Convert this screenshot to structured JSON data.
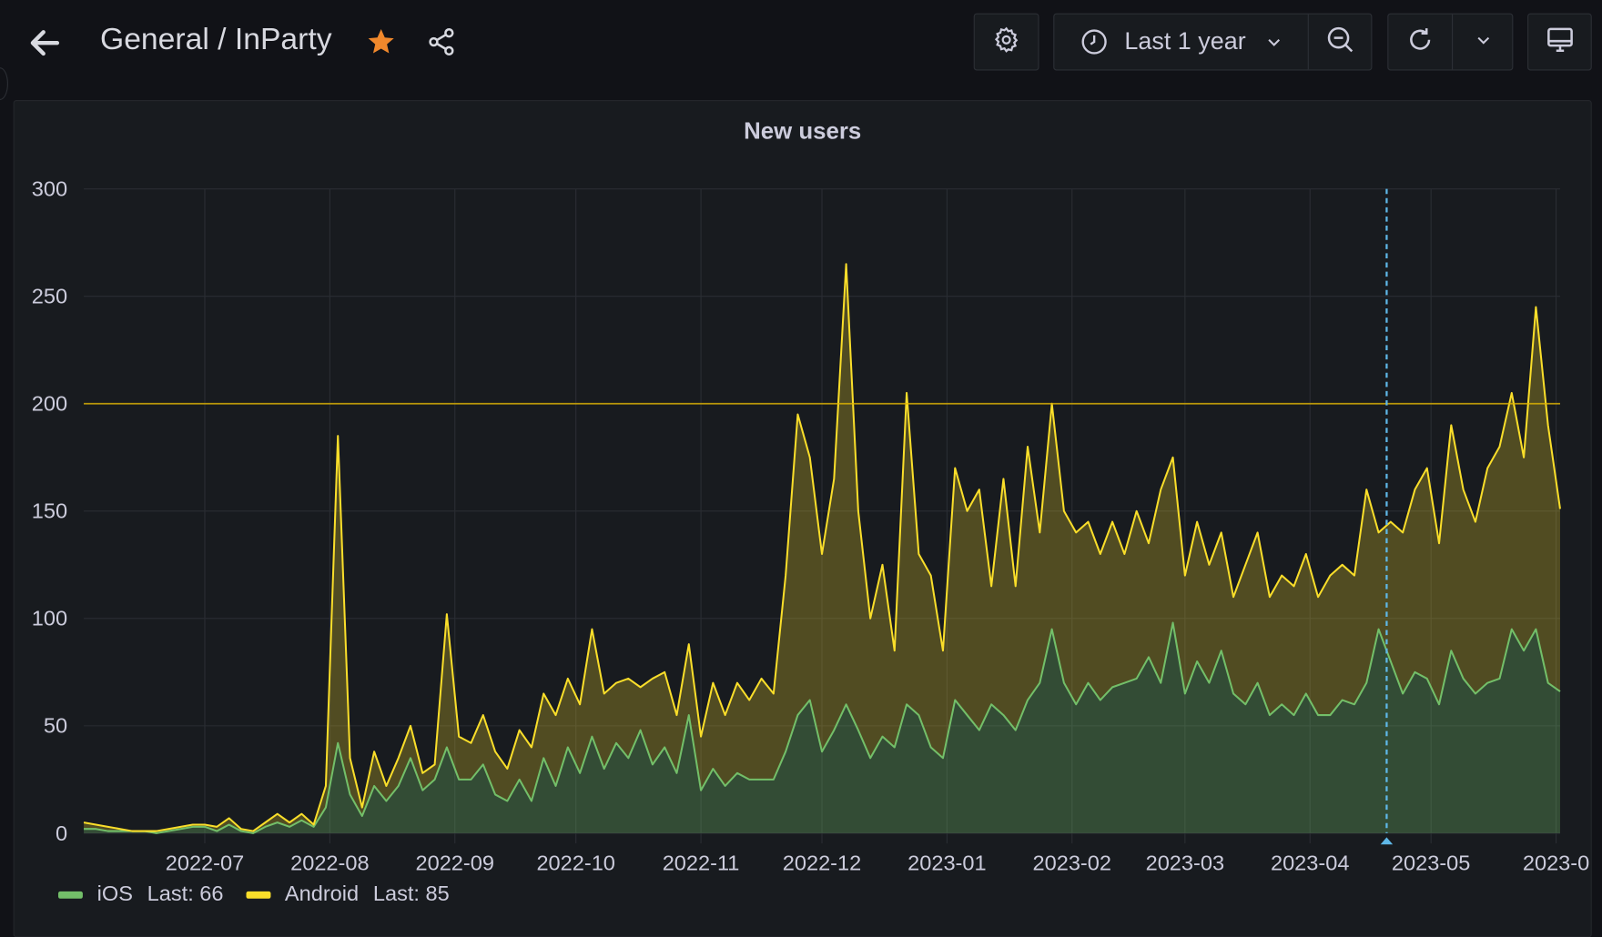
{
  "header": {
    "breadcrumb_folder": "General",
    "breadcrumb_sep": " / ",
    "dashboard_title": "InParty",
    "time_range": "Last 1 year",
    "icons": [
      "arrow-left-icon",
      "star-icon",
      "share-icon",
      "gear-icon",
      "clock-icon",
      "chevron-down-icon",
      "zoom-out-icon",
      "refresh-icon",
      "monitor-icon"
    ],
    "star_color": "#f0882c"
  },
  "panel": {
    "title": "New users"
  },
  "legend": [
    {
      "name": "iOS",
      "stat": "Last: 66",
      "color": "#73bf69"
    },
    {
      "name": "Android",
      "stat": "Last: 85",
      "color": "#fade2a"
    }
  ],
  "chart_data": {
    "type": "area",
    "stacked": true,
    "title": "New users",
    "xlabel": "",
    "ylabel": "",
    "ylim": [
      0,
      300
    ],
    "yticks": [
      "0",
      "50",
      "100",
      "150",
      "200",
      "250",
      "300"
    ],
    "xlim": [
      "2022-06-01",
      "2023-06-02"
    ],
    "xtick_labels": [
      "2022-07",
      "2022-08",
      "2022-09",
      "2022-10",
      "2022-11",
      "2022-12",
      "2023-01",
      "2023-02",
      "2023-03",
      "2023-04",
      "2023-05",
      "2023-0"
    ],
    "xtick_dates": [
      "2022-07-01",
      "2022-08-01",
      "2022-09-01",
      "2022-10-01",
      "2022-11-01",
      "2022-12-01",
      "2023-01-01",
      "2023-02-01",
      "2023-03-01",
      "2023-04-01",
      "2023-05-01",
      "2023-06-01"
    ],
    "grid": true,
    "legend_position": "bottom-left",
    "threshold": {
      "value": 200,
      "color": "#e0b400"
    },
    "cursor_date": "2023-04-20",
    "cursor_color": "#5fb8e8",
    "x": [
      "2022-06-01",
      "2022-06-04",
      "2022-06-07",
      "2022-06-10",
      "2022-06-13",
      "2022-06-16",
      "2022-06-19",
      "2022-06-22",
      "2022-06-25",
      "2022-06-28",
      "2022-07-01",
      "2022-07-04",
      "2022-07-07",
      "2022-07-10",
      "2022-07-13",
      "2022-07-16",
      "2022-07-19",
      "2022-07-22",
      "2022-07-25",
      "2022-07-28",
      "2022-07-31",
      "2022-08-03",
      "2022-08-06",
      "2022-08-09",
      "2022-08-12",
      "2022-08-15",
      "2022-08-18",
      "2022-08-21",
      "2022-08-24",
      "2022-08-27",
      "2022-08-30",
      "2022-09-02",
      "2022-09-05",
      "2022-09-08",
      "2022-09-11",
      "2022-09-14",
      "2022-09-17",
      "2022-09-20",
      "2022-09-23",
      "2022-09-26",
      "2022-09-29",
      "2022-10-02",
      "2022-10-05",
      "2022-10-08",
      "2022-10-11",
      "2022-10-14",
      "2022-10-17",
      "2022-10-20",
      "2022-10-23",
      "2022-10-26",
      "2022-10-29",
      "2022-11-01",
      "2022-11-04",
      "2022-11-07",
      "2022-11-10",
      "2022-11-13",
      "2022-11-16",
      "2022-11-19",
      "2022-11-22",
      "2022-11-25",
      "2022-11-28",
      "2022-12-01",
      "2022-12-04",
      "2022-12-07",
      "2022-12-10",
      "2022-12-13",
      "2022-12-16",
      "2022-12-19",
      "2022-12-22",
      "2022-12-25",
      "2022-12-28",
      "2022-12-31",
      "2023-01-03",
      "2023-01-06",
      "2023-01-09",
      "2023-01-12",
      "2023-01-15",
      "2023-01-18",
      "2023-01-21",
      "2023-01-24",
      "2023-01-27",
      "2023-01-30",
      "2023-02-02",
      "2023-02-05",
      "2023-02-08",
      "2023-02-11",
      "2023-02-14",
      "2023-02-17",
      "2023-02-20",
      "2023-02-23",
      "2023-02-26",
      "2023-03-01",
      "2023-03-04",
      "2023-03-07",
      "2023-03-10",
      "2023-03-13",
      "2023-03-16",
      "2023-03-19",
      "2023-03-22",
      "2023-03-25",
      "2023-03-28",
      "2023-03-31",
      "2023-04-03",
      "2023-04-06",
      "2023-04-09",
      "2023-04-12",
      "2023-04-15",
      "2023-04-18",
      "2023-04-21",
      "2023-04-24",
      "2023-04-27",
      "2023-04-30",
      "2023-05-03",
      "2023-05-06",
      "2023-05-09",
      "2023-05-12",
      "2023-05-15",
      "2023-05-18",
      "2023-05-21",
      "2023-05-24",
      "2023-05-27",
      "2023-05-30",
      "2023-06-02"
    ],
    "series": [
      {
        "name": "iOS",
        "color": "#73bf69",
        "values": [
          2,
          2,
          1,
          1,
          1,
          1,
          0,
          1,
          2,
          3,
          3,
          1,
          4,
          1,
          0,
          3,
          5,
          3,
          6,
          3,
          12,
          42,
          18,
          8,
          22,
          15,
          22,
          35,
          20,
          25,
          40,
          25,
          25,
          32,
          18,
          15,
          25,
          15,
          35,
          22,
          40,
          28,
          45,
          30,
          42,
          35,
          48,
          32,
          40,
          28,
          55,
          20,
          30,
          22,
          28,
          25,
          25,
          25,
          38,
          55,
          62,
          38,
          48,
          60,
          48,
          35,
          45,
          40,
          60,
          55,
          40,
          35,
          62,
          55,
          48,
          60,
          55,
          48,
          62,
          70,
          95,
          70,
          60,
          70,
          62,
          68,
          70,
          72,
          82,
          70,
          98,
          65,
          80,
          70,
          85,
          65,
          60,
          70,
          55,
          60,
          55,
          65,
          55,
          55,
          62,
          60,
          70,
          95,
          80,
          65,
          75,
          72,
          60,
          85,
          72,
          65,
          70,
          72,
          95,
          85,
          95,
          70,
          66
        ]
      },
      {
        "name": "Android",
        "color": "#fade2a",
        "values": [
          3,
          2,
          2,
          1,
          0,
          0,
          1,
          1,
          1,
          1,
          1,
          2,
          3,
          1,
          1,
          2,
          4,
          2,
          3,
          1,
          10,
          143,
          17,
          4,
          16,
          7,
          13,
          15,
          8,
          7,
          62,
          20,
          17,
          23,
          20,
          15,
          23,
          25,
          30,
          33,
          32,
          32,
          50,
          35,
          28,
          37,
          20,
          40,
          35,
          27,
          33,
          25,
          40,
          33,
          42,
          37,
          47,
          40,
          82,
          140,
          113,
          92,
          117,
          205,
          102,
          65,
          80,
          45,
          145,
          75,
          80,
          50,
          108,
          95,
          112,
          55,
          110,
          67,
          118,
          70,
          105,
          80,
          80,
          75,
          68,
          77,
          60,
          78,
          53,
          90,
          77,
          55,
          65,
          55,
          55,
          45,
          65,
          70,
          55,
          60,
          60,
          65,
          55,
          65,
          63,
          60,
          90,
          45,
          65,
          75,
          85,
          98,
          75,
          105,
          88,
          80,
          100,
          108,
          110,
          90,
          150,
          120,
          85
        ]
      }
    ]
  }
}
